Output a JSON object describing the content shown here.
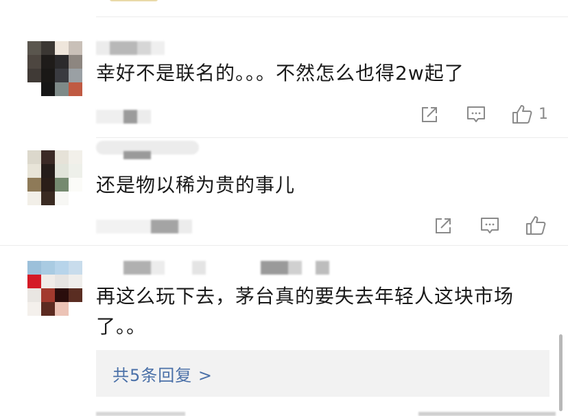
{
  "comments": [
    {
      "text": "幸好不是联名的。。。不然怎么也得2w起了",
      "like_count": "1",
      "icons": [
        "share-icon",
        "reply-icon",
        "like-icon"
      ]
    },
    {
      "text": "还是物以稀为贵的事儿",
      "like_count": "",
      "icons": [
        "share-icon",
        "reply-icon",
        "like-icon"
      ]
    },
    {
      "text": "再这么玩下去，茅台真的要失去年轻人这块市场了。。",
      "reply_summary": "共5条回复 >"
    }
  ],
  "colors": {
    "accent_link": "#4a70a8",
    "icon_gray": "#8a8a8a",
    "reply_bg": "#f2f2f2"
  }
}
